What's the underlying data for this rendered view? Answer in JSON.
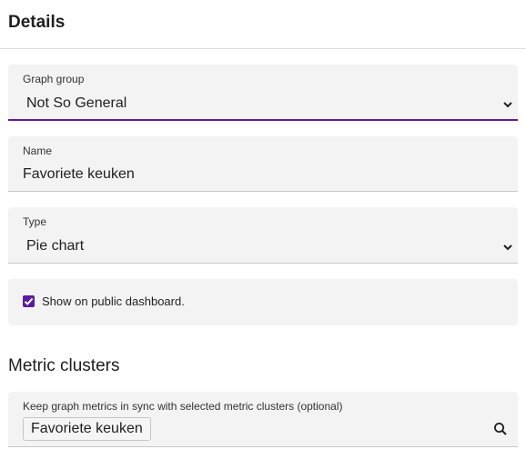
{
  "details": {
    "title": "Details"
  },
  "form": {
    "graph_group": {
      "label": "Graph group",
      "value": "Not So General"
    },
    "name": {
      "label": "Name",
      "value": "Favoriete keuken"
    },
    "type": {
      "label": "Type",
      "value": "Pie chart"
    },
    "public_dashboard": {
      "label": "Show on public dashboard.",
      "checked": true
    }
  },
  "metric_clusters": {
    "title": "Metric clusters",
    "sync_label": "Keep graph metrics in sync with selected metric clusters (optional)",
    "selected": [
      "Favoriete keuken"
    ]
  },
  "icons": {
    "dropdown": "chevron-down-icon",
    "search": "search-icon",
    "check": "check-icon"
  },
  "colors": {
    "accent": "#5b1a9e",
    "field_background": "#f3f3f3"
  }
}
